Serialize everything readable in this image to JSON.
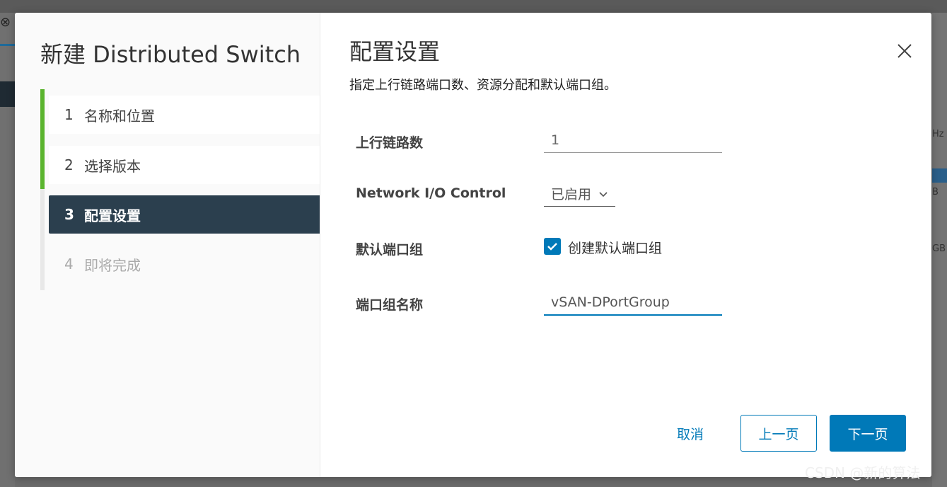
{
  "wizard": {
    "title": "新建 Distributed Switch",
    "steps": [
      {
        "num": "1",
        "label": "名称和位置",
        "state": "done"
      },
      {
        "num": "2",
        "label": "选择版本",
        "state": "done"
      },
      {
        "num": "3",
        "label": "配置设置",
        "state": "active"
      },
      {
        "num": "4",
        "label": "即将完成",
        "state": "pending"
      }
    ]
  },
  "page": {
    "title": "配置设置",
    "subtitle": "指定上行链路端口数、资源分配和默认端口组。",
    "close_icon": "close-icon"
  },
  "form": {
    "uplinks": {
      "label": "上行链路数",
      "value": "1"
    },
    "nioc": {
      "label": "Network I/O Control",
      "value": "已启用"
    },
    "default_portgroup": {
      "label": "默认端口组",
      "checkbox_label": "创建默认端口组",
      "checked": true
    },
    "portgroup_name": {
      "label": "端口组名称",
      "value": "vSAN-DPortGroup"
    }
  },
  "footer": {
    "cancel": "取消",
    "back": "上一页",
    "next": "下一页"
  },
  "watermark": "CSDN @新的算法",
  "colors": {
    "accent": "#0079b8",
    "step_done": "#5ab42e",
    "step_active_bg": "#2b3f4e"
  }
}
